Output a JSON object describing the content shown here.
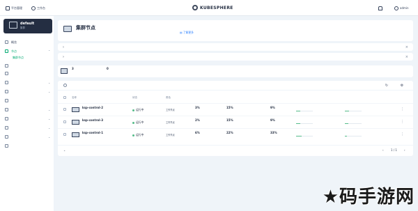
{
  "topbar": {
    "platform_label": "平台管理",
    "workbench_label": "工作台",
    "brand": "KUBESPHERE",
    "user": "admin"
  },
  "workspace": {
    "name": "default",
    "sub": "集群"
  },
  "sidebar": {
    "items": [
      {
        "label": "概览"
      },
      {
        "label": "节点"
      },
      {
        "label": ""
      },
      {
        "label": ""
      },
      {
        "label": ""
      },
      {
        "label": ""
      },
      {
        "label": ""
      },
      {
        "label": ""
      },
      {
        "label": ""
      },
      {
        "label": ""
      },
      {
        "label": ""
      },
      {
        "label": ""
      }
    ],
    "active_sub": "集群节点"
  },
  "page": {
    "title": "集群节点",
    "description": "",
    "learn_more": "了解更多"
  },
  "collapsibles": [
    {
      "label": ""
    },
    {
      "label": ""
    }
  ],
  "stats": [
    {
      "value": "3",
      "label": ""
    },
    {
      "value": "0",
      "label": ""
    }
  ],
  "search": {
    "placeholder": ""
  },
  "table": {
    "headers": [
      "名称",
      "状态",
      "角色",
      "",
      "",
      "",
      "",
      ""
    ],
    "rows": [
      {
        "name": "ksp-control-2",
        "ip": "",
        "status": "运行中",
        "role": "工作节点",
        "cpu": "3%",
        "cpu_sub": "",
        "mem": "15%",
        "mem_sub": "",
        "pods": "9%",
        "pods_sub": "",
        "alloc": "",
        "alloc_pct": 0.23,
        "usage": "",
        "usage_pct": 0.23
      },
      {
        "name": "ksp-control-3",
        "ip": "",
        "status": "运行中",
        "role": "工作节点",
        "cpu": "2%",
        "cpu_sub": "",
        "mem": "15%",
        "mem_sub": "",
        "pods": "9%",
        "pods_sub": "",
        "alloc": "",
        "alloc_pct": 0.23,
        "usage": "",
        "usage_pct": 0.21
      },
      {
        "name": "ksp-control-1",
        "ip": "",
        "status": "运行中",
        "role": "工作节点",
        "cpu": "6%",
        "cpu_sub": "",
        "mem": "22%",
        "mem_sub": "",
        "pods": "33%",
        "pods_sub": "",
        "alloc": "",
        "alloc_pct": 0.33,
        "usage": "",
        "usage_pct": 0.14
      }
    ]
  },
  "footer": {
    "per_page": "",
    "page": "1 / 1"
  },
  "watermark": "★码手游网",
  "colors": {
    "accent": "#00aa72",
    "status_ok": "#55bc8a",
    "dark": "#242e42"
  }
}
